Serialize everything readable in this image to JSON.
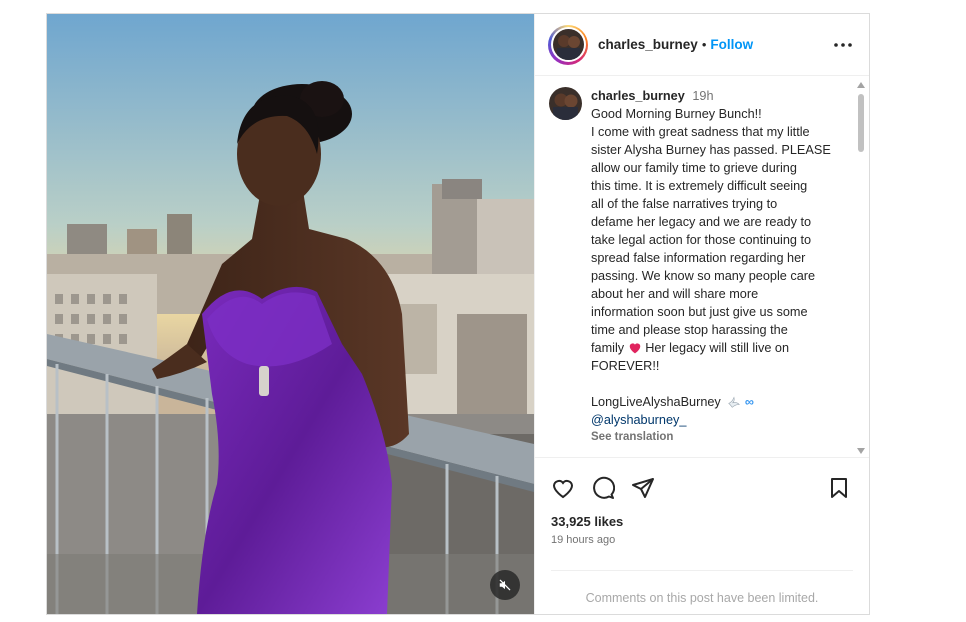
{
  "post": {
    "username": "charles_burney",
    "follow_label": "Follow",
    "dot": "•",
    "caption": {
      "username": "charles_burney",
      "time": "19h",
      "lines": [
        "Good Morning Burney Bunch!!",
        "I come with great sadness that my little",
        "sister Alysha Burney has passed. PLEASE",
        "allow our family time to grieve during",
        "this time. It is extremely difficult seeing",
        "all of the false narratives trying to",
        "defame her legacy and we are ready to",
        "take legal action for those continuing to",
        "spread false information regarding her",
        "passing. We know so many people care",
        "about her and will share more",
        "information soon but just give us some",
        "time and please stop harassing the"
      ],
      "line_before_heart": "family",
      "line_after_heart": "Her legacy will still live on",
      "last_line": "FOREVER!!",
      "hashtag_line": "LongLiveAlyshaBurney",
      "infinity": "∞",
      "mention": "@alyshaburney_",
      "see_translation": "See translation"
    },
    "likes": "33,925 likes",
    "time_ago": "19 hours ago",
    "comments_limited": "Comments on this post have been limited."
  },
  "icons": {
    "more": "more-horizontal-icon",
    "like": "heart-outline-icon",
    "comment": "comment-icon",
    "share": "share-paper-plane-icon",
    "save": "bookmark-icon",
    "mute": "muted-speaker-icon",
    "heart_emoji": "red-heart-emoji",
    "dove_emoji": "dove-emoji"
  },
  "colors": {
    "follow_blue": "#0095f6",
    "text": "#262626",
    "secondary": "#737373",
    "muted": "#a8a8a8",
    "dress_purple": "#6a1fa8"
  }
}
